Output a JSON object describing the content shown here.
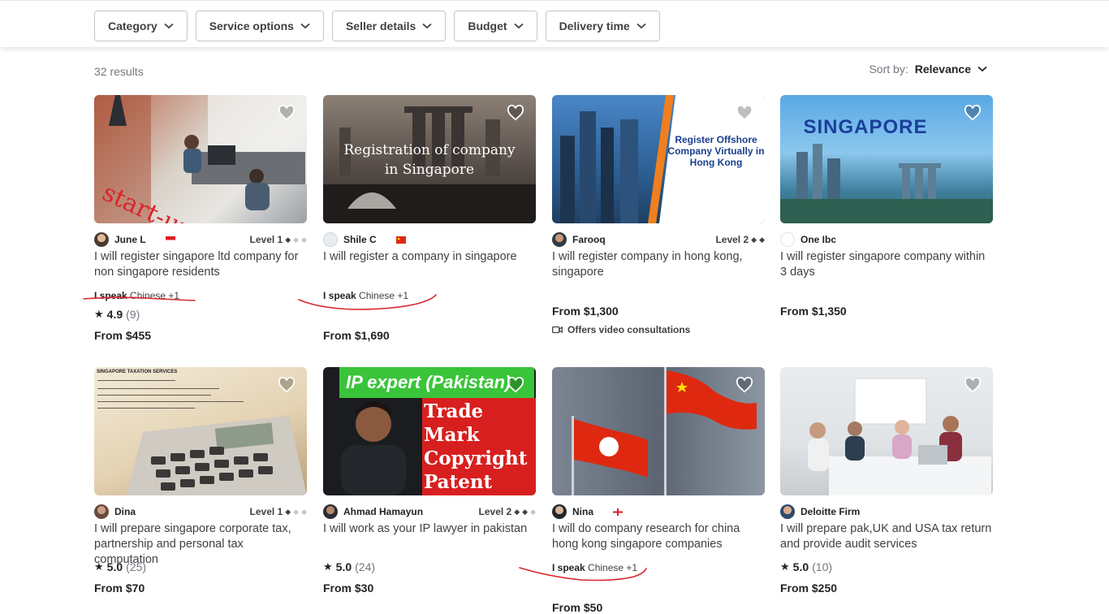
{
  "filters": [
    "Category",
    "Service options",
    "Seller details",
    "Budget",
    "Delivery time"
  ],
  "results": "32 results",
  "sort": {
    "label": "Sort by:",
    "value": "Relevance"
  },
  "cards": [
    {
      "seller": "June L",
      "level": "Level 1",
      "title": "I will register singapore ltd company for non singapore residents",
      "speak_label": "I speak",
      "speak_value": "Chinese +1",
      "score": "4.9",
      "count": "(9)",
      "price": "From $455"
    },
    {
      "seller": "Shile C",
      "title": "I will register a company in singapore",
      "thumb_text": "Registration of company in Singapore",
      "speak_label": "I speak",
      "speak_value": "Chinese +1",
      "price": "From $1,690"
    },
    {
      "seller": "Farooq",
      "level": "Level 2",
      "title": "I will register company in hong kong, singapore",
      "thumb_text": "Register Offshore Company Virtually in Hong Kong",
      "price": "From $1,300",
      "video": "Offers video consultations"
    },
    {
      "seller": "One Ibc",
      "title": "I will register singapore company within 3 days",
      "thumb_text": "SINGAPORE",
      "price": "From $1,350"
    },
    {
      "seller": "Dina",
      "level": "Level 1",
      "title": "I will prepare singapore corporate tax, partnership and personal tax computation",
      "thumb_text": "SINGAPORE TAXATION SERVICES",
      "score": "5.0",
      "count": "(25)",
      "price": "From $70"
    },
    {
      "seller": "Ahmad Hamayun",
      "level": "Level 2",
      "title": "I will work as your IP lawyer in pakistan",
      "thumb_text": "IP expert (Pakistan)",
      "thumb_text2": "Trade Mark Copyright Patent Design",
      "score": "5.0",
      "count": "(24)",
      "price": "From $30"
    },
    {
      "seller": "Nina",
      "title": "I will do company research for china hong kong singapore companies",
      "speak_label": "I speak",
      "speak_value": "Chinese +1",
      "price": "From $50"
    },
    {
      "seller": "Deloitte Firm",
      "title": "I will prepare pak,UK and USA tax return and provide audit services",
      "score": "5.0",
      "count": "(10)",
      "price": "From $250"
    }
  ],
  "colors": {
    "annotation": "#d9252a",
    "text": "#404145",
    "muted": "#74767e",
    "border": "#c5c6c9"
  }
}
